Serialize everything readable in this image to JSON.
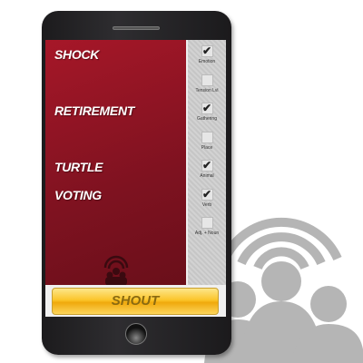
{
  "words": [
    "Shock",
    "Retirement",
    "Turtle",
    "Voting"
  ],
  "options": [
    {
      "label": "Emotion",
      "checked": true
    },
    {
      "label": "Tension Lvl",
      "checked": false
    },
    {
      "label": "Gathering",
      "checked": true
    },
    {
      "label": "Place",
      "checked": false
    },
    {
      "label": "Animal",
      "checked": true
    },
    {
      "label": "Verb",
      "checked": true
    },
    {
      "label": "Adj. + Noun",
      "checked": false
    }
  ],
  "shout_label": "SHOUT",
  "colors": {
    "red": "#8e1424",
    "button": "#fbc52a",
    "icon": "#b5b5b5"
  }
}
